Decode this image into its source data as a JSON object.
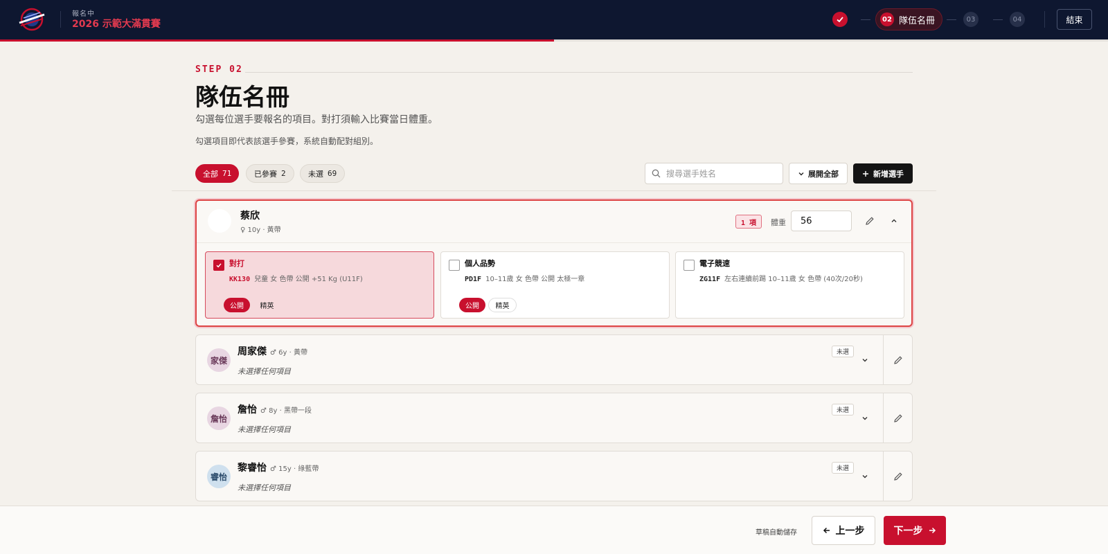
{
  "header": {
    "status_label": "報名中",
    "event_title": "2026 示範大滿貫賽",
    "steps": [
      {
        "num": "",
        "state": "done"
      },
      {
        "num": "02",
        "label": "隊伍名冊",
        "state": "active"
      },
      {
        "num": "03",
        "state": "future"
      },
      {
        "num": "04",
        "state": "future"
      }
    ],
    "end_label": "結束",
    "progress": 0.5
  },
  "page": {
    "eyebrow": "STEP 02",
    "title": "隊伍名冊",
    "description": "勾選每位選手要報名的項目。對打須輸入比賽當日體重。",
    "note": "勾選項目即代表該選手參賽，系統自動配對組別。"
  },
  "filters": [
    {
      "label": "全部",
      "count": "71",
      "active": true
    },
    {
      "label": "已參賽",
      "count": "2",
      "active": false
    },
    {
      "label": "未選",
      "count": "69",
      "active": false
    }
  ],
  "toolbar": {
    "search_placeholder": "搜尋選手姓名",
    "expand_label": "展開全部",
    "add_label": "新增選手"
  },
  "athletes": [
    {
      "name": "蔡欣",
      "meta": "♀ 10y · 黃帶",
      "count_badge": "1 項",
      "weight_label": "體重",
      "weight": "56",
      "expanded": true,
      "events": [
        {
          "title": "對打",
          "code": "KK130",
          "desc": "兒童 女 色帶 公開 +51 Kg (U11F)",
          "selected": true,
          "tags": [
            "公開",
            "精英"
          ]
        },
        {
          "title": "個人品勢",
          "code": "PD1F",
          "desc": "10–11歲 女 色帶 公開 太極一章",
          "selected": false,
          "tags": [
            "公開",
            "精英"
          ]
        },
        {
          "title": "電子競速",
          "code": "ZG11F",
          "desc": "左右連續前踢 10–11歲 女 色帶 (40次/20秒)",
          "selected": false,
          "tags": []
        }
      ]
    },
    {
      "initials": "家傑",
      "name": "周家傑",
      "meta": "♂ 6y · 黃帶",
      "status": "未選",
      "none_text": "未選擇任何項目",
      "avatar_bg": "#e8d6e2",
      "avatar_fg": "#6a3a5a"
    },
    {
      "initials": "詹怡",
      "name": "詹怡",
      "meta": "♂ 8y · 黑帶一段",
      "status": "未選",
      "none_text": "未選擇任何項目",
      "avatar_bg": "#e8d6e2",
      "avatar_fg": "#6a3a5a"
    },
    {
      "initials": "睿怡",
      "name": "黎睿怡",
      "meta": "♂ 15y · 綠藍帶",
      "status": "未選",
      "none_text": "未選擇任何項目",
      "avatar_bg": "#cfe0ee",
      "avatar_fg": "#2a4a6a"
    }
  ],
  "footer": {
    "autosave": "草稿自動儲存",
    "prev_label": "上一步",
    "next_label": "下一步"
  },
  "colors": {
    "accent": "#c8102e",
    "header_bg": "#0e1730",
    "page_bg": "#f4f1ec"
  }
}
